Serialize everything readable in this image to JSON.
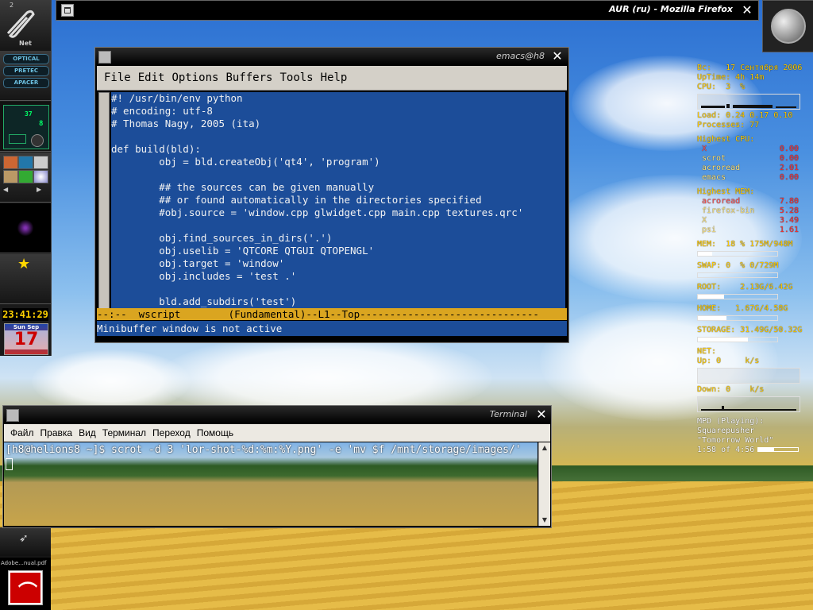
{
  "window_titles": {
    "firefox": "AUR (ru) - Mozilla Firefox",
    "emacs": "emacs@h8",
    "terminal": "Terminal"
  },
  "dock": {
    "workspace_number": "2",
    "net_label": "Net",
    "drives": [
      "OPTICAL",
      "PRETEC",
      "APACER"
    ],
    "mixer_value": "37",
    "mixer_value2": "8",
    "clock": "23:41:29",
    "calendar_day_line": "Sun  Sep",
    "calendar_day_number": "17",
    "taskbar_label": "Adobe...nual.pdf"
  },
  "emacs": {
    "menu": [
      "File",
      "Edit",
      "Options",
      "Buffers",
      "Tools",
      "Help"
    ],
    "code_lines": [
      "#! /usr/bin/env python",
      "# encoding: utf-8",
      "# Thomas Nagy, 2005 (ita)",
      "",
      "def build(bld):",
      "        obj = bld.createObj('qt4', 'program')",
      "",
      "        ## the sources can be given manually",
      "        ## or found automatically in the directories specified",
      "        #obj.source = 'window.cpp glwidget.cpp main.cpp textures.qrc'",
      "",
      "        obj.find_sources_in_dirs('.')",
      "        obj.uselib = 'QTCORE QTGUI QTOPENGL'",
      "        obj.target = 'window'",
      "        obj.includes = 'test .'",
      "",
      "        bld.add_subdirs('test')"
    ],
    "modeline": "--:--  wscript        (Fundamental)--L1--Top------------------------------",
    "minibuffer": "Minibuffer window is not active"
  },
  "terminal": {
    "menu": [
      "Файл",
      "Правка",
      "Вид",
      "Терминал",
      "Переход",
      "Помощь"
    ],
    "command_line": "[h8@helions8 ~]$ scrot -d 3 'lor-shot-%d:%m:%Y.png' -e 'mv $f /mnt/storage/images/'"
  },
  "conky": {
    "date_line": "Вс:   17 Сентября 2006",
    "uptime_line": "UpTime: 4h 14m",
    "cpu_line": "CPU:  3  %",
    "load_line": "Load: 0.24 0.17 0.10",
    "processes_line": "Processes: 77",
    "highest_cpu_title": "Highest CPU:",
    "highest_cpu": [
      {
        "name": "X",
        "value": "0.00"
      },
      {
        "name": "scrot",
        "value": "0.00"
      },
      {
        "name": "acroread",
        "value": "2.01"
      },
      {
        "name": "emacs",
        "value": "0.00"
      }
    ],
    "highest_mem_title": "Highest MEM:",
    "highest_mem": [
      {
        "name": "acroread",
        "value": "7.80"
      },
      {
        "name": "firefox-bin",
        "value": "5.28"
      },
      {
        "name": "X",
        "value": "3.49"
      },
      {
        "name": "psi",
        "value": "1.61"
      }
    ],
    "mem_line": "MEM:  18 % 175M/948M",
    "mem_fraction": 0.18,
    "swap_line": "SWAP: 0  % 0/729M",
    "swap_fraction": 0,
    "root_line": "ROOT:    2.13G/6.42G",
    "root_fraction": 0.33,
    "home_line": "HOME:   1.67G/4.58G",
    "home_fraction": 0.36,
    "storage_line": "STORAGE: 31.49G/50.32G",
    "storage_fraction": 0.63,
    "net_title": "NET:",
    "up_line": "Up: 0     k/s",
    "down_line": "Down: 0    k/s",
    "mpd_status": "MPD (Playing):",
    "mpd_artist": "Squarepusher",
    "mpd_title": "\"Tomorrow World\"",
    "mpd_time": "1:58 of 4:56",
    "mpd_fraction": 0.4
  },
  "colors": {
    "emacs_bg": "#1c4d99",
    "modeline": "#daa520",
    "conky_text": "#ffcc00",
    "conky_value": "#ff3030"
  }
}
